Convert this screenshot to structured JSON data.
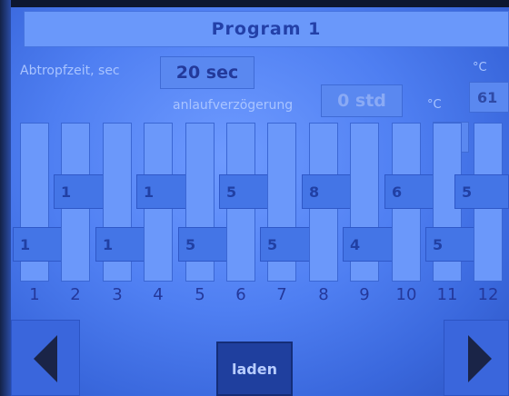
{
  "header": {
    "title": "Program 1"
  },
  "drip_time": {
    "label": "Abtropfzeit, sec",
    "value": "20 sec"
  },
  "start_delay": {
    "label": "anlaufverzögerung",
    "value": "0 std"
  },
  "temperature": {
    "unit_top": "°C",
    "unit": "°C",
    "value_top": "61",
    "value": "61"
  },
  "steps": [
    {
      "number": "1",
      "value": "1",
      "level": "low"
    },
    {
      "number": "2",
      "value": "1",
      "level": "high"
    },
    {
      "number": "3",
      "value": "1",
      "level": "low"
    },
    {
      "number": "4",
      "value": "1",
      "level": "high"
    },
    {
      "number": "5",
      "value": "5",
      "level": "low"
    },
    {
      "number": "6",
      "value": "5",
      "level": "high"
    },
    {
      "number": "7",
      "value": "5",
      "level": "low"
    },
    {
      "number": "8",
      "value": "8",
      "level": "high"
    },
    {
      "number": "9",
      "value": "4",
      "level": "low"
    },
    {
      "number": "10",
      "value": "6",
      "level": "high"
    },
    {
      "number": "11",
      "value": "5",
      "level": "low"
    },
    {
      "number": "12",
      "value": "5",
      "level": "high"
    }
  ],
  "footer": {
    "load_label": "laden",
    "prev_icon": "arrow-left-icon",
    "next_icon": "arrow-right-icon"
  },
  "colors": {
    "screen": "#4f7ff2",
    "accent": "#1f3f9e",
    "text_dark": "#2340a8"
  }
}
